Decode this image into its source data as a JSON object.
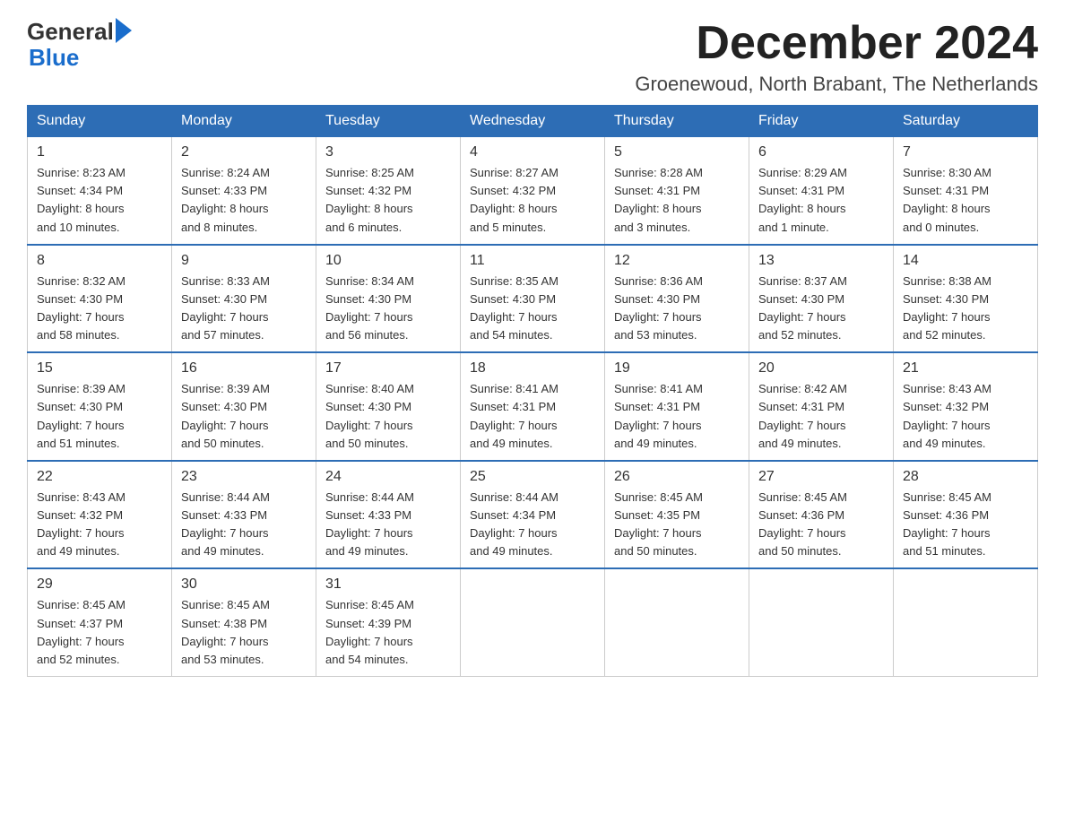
{
  "header": {
    "logo_general": "General",
    "logo_blue": "Blue",
    "month_title": "December 2024",
    "location": "Groenewoud, North Brabant, The Netherlands"
  },
  "weekdays": [
    "Sunday",
    "Monday",
    "Tuesday",
    "Wednesday",
    "Thursday",
    "Friday",
    "Saturday"
  ],
  "weeks": [
    [
      {
        "day": "1",
        "sunrise": "8:23 AM",
        "sunset": "4:34 PM",
        "daylight": "8 hours and 10 minutes."
      },
      {
        "day": "2",
        "sunrise": "8:24 AM",
        "sunset": "4:33 PM",
        "daylight": "8 hours and 8 minutes."
      },
      {
        "day": "3",
        "sunrise": "8:25 AM",
        "sunset": "4:32 PM",
        "daylight": "8 hours and 6 minutes."
      },
      {
        "day": "4",
        "sunrise": "8:27 AM",
        "sunset": "4:32 PM",
        "daylight": "8 hours and 5 minutes."
      },
      {
        "day": "5",
        "sunrise": "8:28 AM",
        "sunset": "4:31 PM",
        "daylight": "8 hours and 3 minutes."
      },
      {
        "day": "6",
        "sunrise": "8:29 AM",
        "sunset": "4:31 PM",
        "daylight": "8 hours and 1 minute."
      },
      {
        "day": "7",
        "sunrise": "8:30 AM",
        "sunset": "4:31 PM",
        "daylight": "8 hours and 0 minutes."
      }
    ],
    [
      {
        "day": "8",
        "sunrise": "8:32 AM",
        "sunset": "4:30 PM",
        "daylight": "7 hours and 58 minutes."
      },
      {
        "day": "9",
        "sunrise": "8:33 AM",
        "sunset": "4:30 PM",
        "daylight": "7 hours and 57 minutes."
      },
      {
        "day": "10",
        "sunrise": "8:34 AM",
        "sunset": "4:30 PM",
        "daylight": "7 hours and 56 minutes."
      },
      {
        "day": "11",
        "sunrise": "8:35 AM",
        "sunset": "4:30 PM",
        "daylight": "7 hours and 54 minutes."
      },
      {
        "day": "12",
        "sunrise": "8:36 AM",
        "sunset": "4:30 PM",
        "daylight": "7 hours and 53 minutes."
      },
      {
        "day": "13",
        "sunrise": "8:37 AM",
        "sunset": "4:30 PM",
        "daylight": "7 hours and 52 minutes."
      },
      {
        "day": "14",
        "sunrise": "8:38 AM",
        "sunset": "4:30 PM",
        "daylight": "7 hours and 52 minutes."
      }
    ],
    [
      {
        "day": "15",
        "sunrise": "8:39 AM",
        "sunset": "4:30 PM",
        "daylight": "7 hours and 51 minutes."
      },
      {
        "day": "16",
        "sunrise": "8:39 AM",
        "sunset": "4:30 PM",
        "daylight": "7 hours and 50 minutes."
      },
      {
        "day": "17",
        "sunrise": "8:40 AM",
        "sunset": "4:30 PM",
        "daylight": "7 hours and 50 minutes."
      },
      {
        "day": "18",
        "sunrise": "8:41 AM",
        "sunset": "4:31 PM",
        "daylight": "7 hours and 49 minutes."
      },
      {
        "day": "19",
        "sunrise": "8:41 AM",
        "sunset": "4:31 PM",
        "daylight": "7 hours and 49 minutes."
      },
      {
        "day": "20",
        "sunrise": "8:42 AM",
        "sunset": "4:31 PM",
        "daylight": "7 hours and 49 minutes."
      },
      {
        "day": "21",
        "sunrise": "8:43 AM",
        "sunset": "4:32 PM",
        "daylight": "7 hours and 49 minutes."
      }
    ],
    [
      {
        "day": "22",
        "sunrise": "8:43 AM",
        "sunset": "4:32 PM",
        "daylight": "7 hours and 49 minutes."
      },
      {
        "day": "23",
        "sunrise": "8:44 AM",
        "sunset": "4:33 PM",
        "daylight": "7 hours and 49 minutes."
      },
      {
        "day": "24",
        "sunrise": "8:44 AM",
        "sunset": "4:33 PM",
        "daylight": "7 hours and 49 minutes."
      },
      {
        "day": "25",
        "sunrise": "8:44 AM",
        "sunset": "4:34 PM",
        "daylight": "7 hours and 49 minutes."
      },
      {
        "day": "26",
        "sunrise": "8:45 AM",
        "sunset": "4:35 PM",
        "daylight": "7 hours and 50 minutes."
      },
      {
        "day": "27",
        "sunrise": "8:45 AM",
        "sunset": "4:36 PM",
        "daylight": "7 hours and 50 minutes."
      },
      {
        "day": "28",
        "sunrise": "8:45 AM",
        "sunset": "4:36 PM",
        "daylight": "7 hours and 51 minutes."
      }
    ],
    [
      {
        "day": "29",
        "sunrise": "8:45 AM",
        "sunset": "4:37 PM",
        "daylight": "7 hours and 52 minutes."
      },
      {
        "day": "30",
        "sunrise": "8:45 AM",
        "sunset": "4:38 PM",
        "daylight": "7 hours and 53 minutes."
      },
      {
        "day": "31",
        "sunrise": "8:45 AM",
        "sunset": "4:39 PM",
        "daylight": "7 hours and 54 minutes."
      },
      null,
      null,
      null,
      null
    ]
  ],
  "labels": {
    "sunrise": "Sunrise:",
    "sunset": "Sunset:",
    "daylight": "Daylight:"
  }
}
